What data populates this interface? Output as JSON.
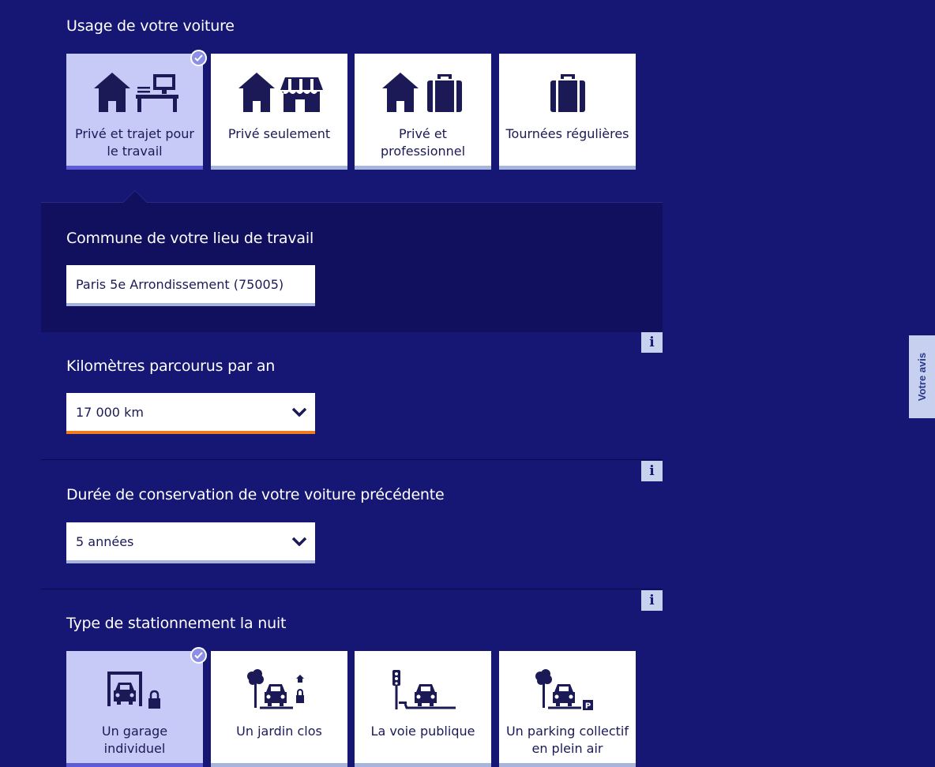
{
  "usage": {
    "title": "Usage de votre voiture",
    "options": [
      {
        "label": "Privé et trajet pour le travail",
        "selected": true,
        "icon": "house-desk-icon"
      },
      {
        "label": "Privé seulement",
        "selected": false,
        "icon": "house-shop-icon"
      },
      {
        "label": "Privé et professionnel",
        "selected": false,
        "icon": "house-briefcase-icon"
      },
      {
        "label": "Tournées régulières",
        "selected": false,
        "icon": "briefcase-icon"
      }
    ]
  },
  "workplace": {
    "title": "Commune de votre lieu de travail",
    "value": "Paris 5e Arrondissement (75005)"
  },
  "mileage": {
    "title": "Kilomètres parcourus par an",
    "value": "17 000 km"
  },
  "previous_car": {
    "title": "Durée de conservation de votre voiture précédente",
    "value": "5 années"
  },
  "parking": {
    "title": "Type de stationnement la nuit",
    "options": [
      {
        "label": "Un garage individuel",
        "selected": true,
        "icon": "garage-icon"
      },
      {
        "label": "Un jardin clos",
        "selected": false,
        "icon": "closed-garden-icon"
      },
      {
        "label": "La voie publique",
        "selected": false,
        "icon": "street-icon"
      },
      {
        "label": "Un parking collectif en plein air",
        "selected": false,
        "icon": "outdoor-parking-icon"
      }
    ]
  },
  "info_label": "i",
  "feedback_tab": "Votre avis",
  "colors": {
    "background": "#161674",
    "panel": "#10105e",
    "tile_selected": "#c7c9f6",
    "accent_orange": "#f07c1e",
    "icon": "#1b1a56"
  }
}
